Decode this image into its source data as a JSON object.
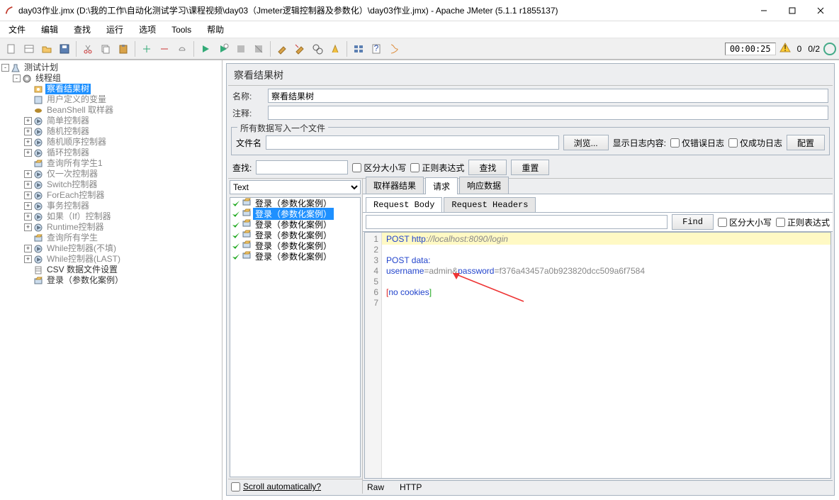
{
  "window": {
    "title": "day03作业.jmx (D:\\我的工作\\自动化测试学习\\课程视频\\day03（Jmeter逻辑控制器及参数化）\\day03作业.jmx) - Apache JMeter (5.1.1 r1855137)"
  },
  "menu": {
    "items": [
      "文件",
      "编辑",
      "查找",
      "运行",
      "选项",
      "Tools",
      "帮助"
    ]
  },
  "status": {
    "timer": "00:00:25",
    "active": "0",
    "total": "0/2"
  },
  "tree": {
    "root": "测试计划",
    "thread_group": "线程组",
    "nodes": [
      {
        "label": "察看结果树",
        "sel": true,
        "icon": "eye"
      },
      {
        "label": "用户定义的变量",
        "gray": true,
        "icon": "vars"
      },
      {
        "label": "BeanShell 取样器",
        "gray": true,
        "icon": "bean"
      },
      {
        "label": "简单控制器",
        "gray": true,
        "icon": "ctrl",
        "exp": true
      },
      {
        "label": "随机控制器",
        "gray": true,
        "icon": "ctrl",
        "exp": true
      },
      {
        "label": "随机顺序控制器",
        "gray": true,
        "icon": "ctrl",
        "exp": true
      },
      {
        "label": "循环控制器",
        "gray": true,
        "icon": "ctrl",
        "exp": true
      },
      {
        "label": "查询所有学生1",
        "gray": true,
        "icon": "http"
      },
      {
        "label": "仅一次控制器",
        "gray": true,
        "icon": "ctrl",
        "exp": true
      },
      {
        "label": "Switch控制器",
        "gray": true,
        "icon": "ctrl",
        "exp": true
      },
      {
        "label": "ForEach控制器",
        "gray": true,
        "icon": "ctrl",
        "exp": true
      },
      {
        "label": "事务控制器",
        "gray": true,
        "icon": "ctrl",
        "exp": true
      },
      {
        "label": "如果（If）控制器",
        "gray": true,
        "icon": "ctrl",
        "exp": true
      },
      {
        "label": "Runtime控制器",
        "gray": true,
        "icon": "ctrl",
        "exp": true
      },
      {
        "label": "查询所有学生",
        "gray": true,
        "icon": "http"
      },
      {
        "label": "While控制器(不填)",
        "gray": true,
        "icon": "ctrl",
        "exp": true
      },
      {
        "label": "While控制器(LAST)",
        "gray": true,
        "icon": "ctrl",
        "exp": true
      },
      {
        "label": "CSV 数据文件设置",
        "icon": "csv"
      },
      {
        "label": "登录（参数化案例）",
        "icon": "http"
      }
    ]
  },
  "panel": {
    "header": "察看结果树",
    "name_label": "名称:",
    "name_value": "察看结果树",
    "comment_label": "注释:",
    "file_legend": "所有数据写入一个文件",
    "file_label": "文件名",
    "browse": "浏览...",
    "logopt_label": "显示日志内容:",
    "only_err": "仅错误日志",
    "only_ok": "仅成功日志",
    "configure": "配置",
    "search_label": "查找:",
    "case_sens": "区分大小写",
    "regex": "正则表达式",
    "search_btn": "查找",
    "reset_btn": "重置"
  },
  "results": {
    "view_selector": "Text",
    "items": [
      {
        "label": "登录（参数化案例）"
      },
      {
        "label": "登录（参数化案例）",
        "sel": true
      },
      {
        "label": "登录（参数化案例）"
      },
      {
        "label": "登录（参数化案例）"
      },
      {
        "label": "登录（参数化案例）"
      },
      {
        "label": "登录（参数化案例）"
      }
    ],
    "scroll_label": "Scroll automatically?",
    "tabs": {
      "sampler": "取样器结果",
      "request": "请求",
      "response": "响应数据"
    },
    "subtabs": {
      "body": "Request Body",
      "headers": "Request Headers"
    },
    "find": {
      "btn": "Find",
      "case": "区分大小写",
      "regex": "正则表达式"
    },
    "raw_label": "Raw",
    "http_label": "HTTP",
    "code": {
      "line1_method": "POST",
      "line1_proto": "http",
      "line1_url": "://localhost:8090/login",
      "line3": "POST data:",
      "line4_a": "username",
      "line4_b": "=admin",
      "line4_c": "&",
      "line4_d": "password",
      "line4_e": "=f376a43457a0b923820dcc509a6f7584",
      "line6_a": "[",
      "line6_b": "no cookies",
      "line6_c": "]"
    }
  }
}
